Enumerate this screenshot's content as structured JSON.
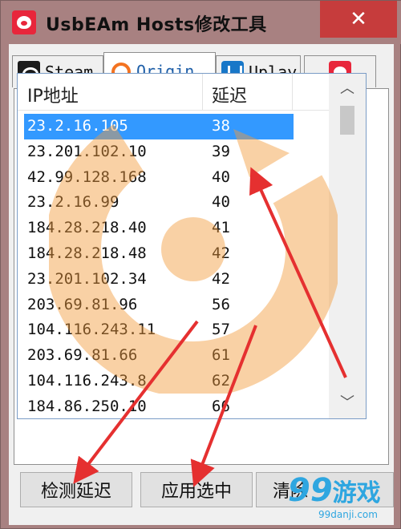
{
  "window": {
    "title": "UsbEAm Hosts修改工具",
    "close_glyph": "✕"
  },
  "tabs": [
    {
      "label": "Steam",
      "icon": "steam-icon"
    },
    {
      "label": "Origin",
      "icon": "origin-icon"
    },
    {
      "label": "Uplay",
      "icon": "uplay-icon"
    },
    {
      "label": "",
      "icon": "app-logo-icon"
    }
  ],
  "active_tab": "Origin",
  "list": {
    "columns": [
      "IP地址",
      "延迟"
    ],
    "rows": [
      {
        "ip": "23.2.16.105",
        "delay": "38",
        "selected": true
      },
      {
        "ip": "23.201.102.10",
        "delay": "39"
      },
      {
        "ip": "42.99.128.168",
        "delay": "40"
      },
      {
        "ip": "23.2.16.99",
        "delay": "40"
      },
      {
        "ip": "184.28.218.40",
        "delay": "41"
      },
      {
        "ip": "184.28.218.48",
        "delay": "42"
      },
      {
        "ip": "23.201.102.34",
        "delay": "42"
      },
      {
        "ip": "203.69.81.96",
        "delay": "56"
      },
      {
        "ip": "104.116.243.11",
        "delay": "57"
      },
      {
        "ip": "203.69.81.66",
        "delay": "61"
      },
      {
        "ip": "104.116.243.8",
        "delay": "62"
      },
      {
        "ip": "184.86.250.10",
        "delay": "66"
      }
    ]
  },
  "buttons": {
    "detect": "检测延迟",
    "apply": "应用选中",
    "clear": "清除"
  },
  "watermark": {
    "logo_text": "99",
    "logo_cn": "游戏",
    "logo_url": "99danji.com"
  },
  "colors": {
    "selection": "#3399ff",
    "arrow": "#e53030",
    "close": "#c63c3c"
  }
}
